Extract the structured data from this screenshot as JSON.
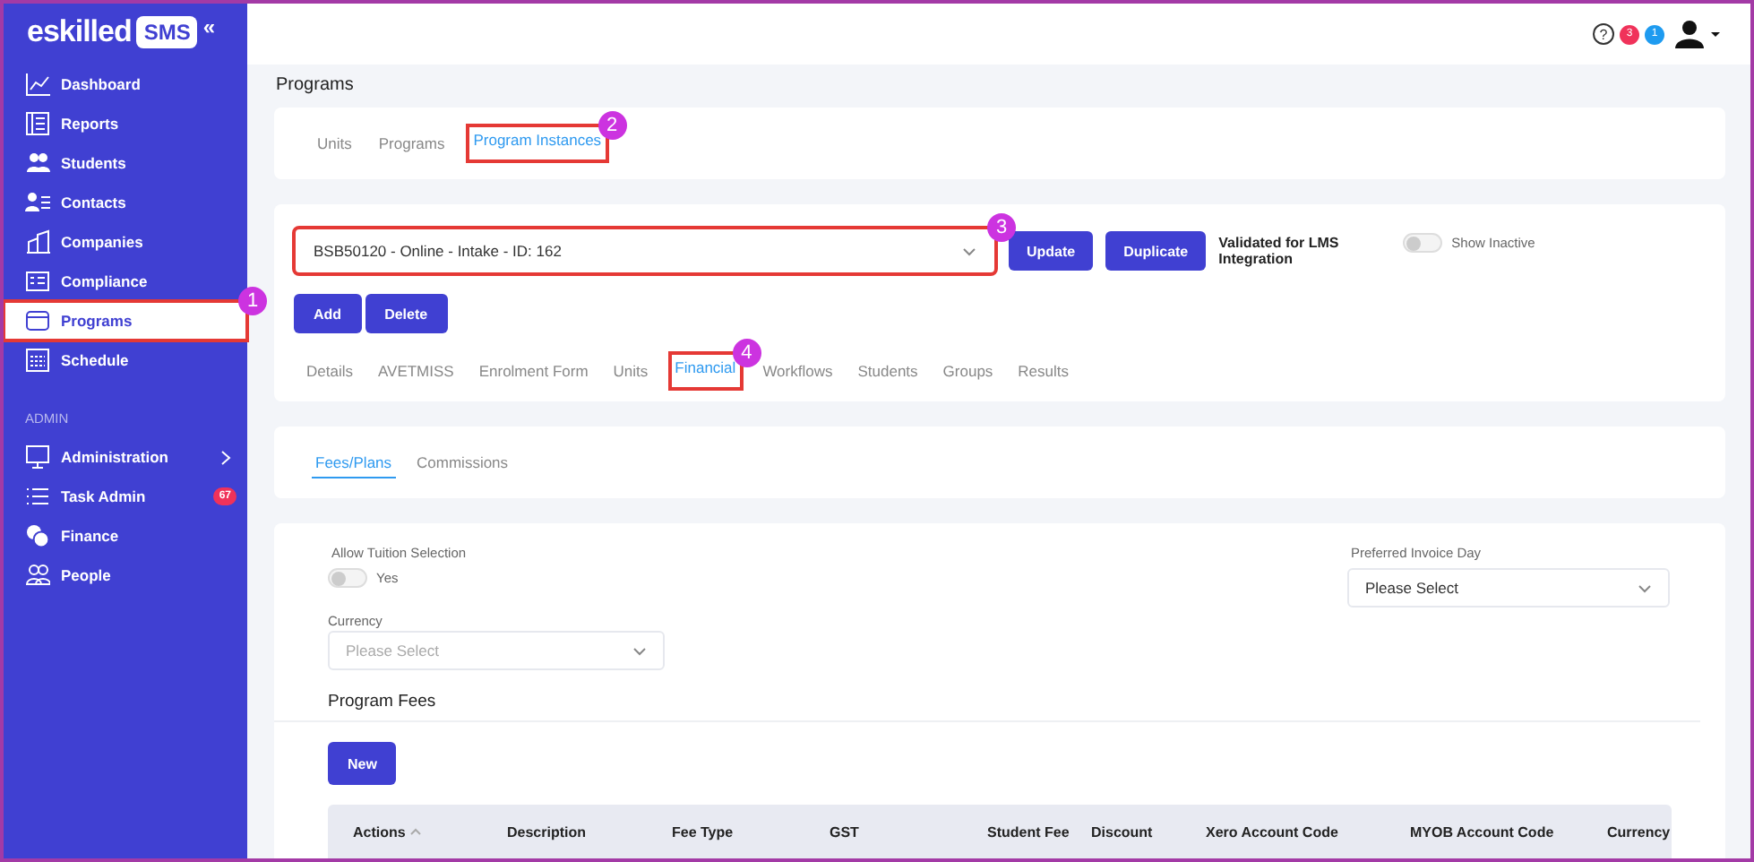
{
  "sidebar": {
    "logo_text": "eskilled",
    "logo_badge": "SMS",
    "collapse": "«",
    "items": [
      {
        "label": "Dashboard",
        "selected": false
      },
      {
        "label": "Reports",
        "selected": false
      },
      {
        "label": "Students",
        "selected": false
      },
      {
        "label": "Contacts",
        "selected": false
      },
      {
        "label": "Companies",
        "selected": false
      },
      {
        "label": "Compliance",
        "selected": false
      },
      {
        "label": "Programs",
        "selected": true,
        "callout": "1"
      },
      {
        "label": "Schedule",
        "selected": false
      }
    ],
    "section": "ADMIN",
    "admin_items": [
      {
        "label": "Administration",
        "selected": false,
        "expandable": true
      },
      {
        "label": "Task Admin",
        "selected": false,
        "badge": "67"
      },
      {
        "label": "Finance",
        "selected": false
      },
      {
        "label": "People",
        "selected": false
      }
    ]
  },
  "topbar": {
    "help": "?",
    "badges": [
      {
        "count": "3",
        "color": "#f0325a"
      },
      {
        "count": "1",
        "color": "#1e9bf0"
      }
    ]
  },
  "page_title": "Programs",
  "main_tabs": [
    {
      "label": "Units",
      "selected": false
    },
    {
      "label": "Programs",
      "selected": false
    },
    {
      "label": "Program Instances",
      "selected": true,
      "callout": "2"
    }
  ],
  "instance": {
    "select_value": "BSB50120 - Online - Intake - ID: 162",
    "callout": "3",
    "buttons": [
      "Update",
      "Duplicate"
    ],
    "validated_text": "Validated for LMS Integration",
    "show_inactive": {
      "label": "Show Inactive",
      "on": false
    },
    "action_buttons": [
      "Add",
      "Delete"
    ]
  },
  "instance_tabs": [
    {
      "label": "Details",
      "selected": false
    },
    {
      "label": "AVETMISS",
      "selected": false
    },
    {
      "label": "Enrolment Form",
      "selected": false
    },
    {
      "label": "Units",
      "selected": false
    },
    {
      "label": "Financial",
      "selected": true,
      "callout": "4"
    },
    {
      "label": "Workflows",
      "selected": false
    },
    {
      "label": "Students",
      "selected": false
    },
    {
      "label": "Groups",
      "selected": false
    },
    {
      "label": "Results",
      "selected": false
    }
  ],
  "financial_tabs": [
    {
      "label": "Fees/Plans",
      "selected": true
    },
    {
      "label": "Commissions",
      "selected": false
    }
  ],
  "fees": {
    "allow_tuition": {
      "label": "Allow Tuition Selection",
      "toggle_label": "Yes",
      "on": false
    },
    "invoice_day": {
      "label": "Preferred Invoice Day",
      "value": "Please Select"
    },
    "currency": {
      "label": "Currency",
      "placeholder": "Please Select"
    },
    "program_fees_title": "Program Fees",
    "new_button": "New",
    "columns": [
      {
        "label": "Actions",
        "sorted": true
      },
      {
        "label": "Description"
      },
      {
        "label": "Fee Type"
      },
      {
        "label": "GST"
      },
      {
        "label": "Student Fee"
      },
      {
        "label": "Discount"
      },
      {
        "label": "Xero Account Code"
      },
      {
        "label": "MYOB Account Code"
      },
      {
        "label": "Currency"
      }
    ]
  }
}
